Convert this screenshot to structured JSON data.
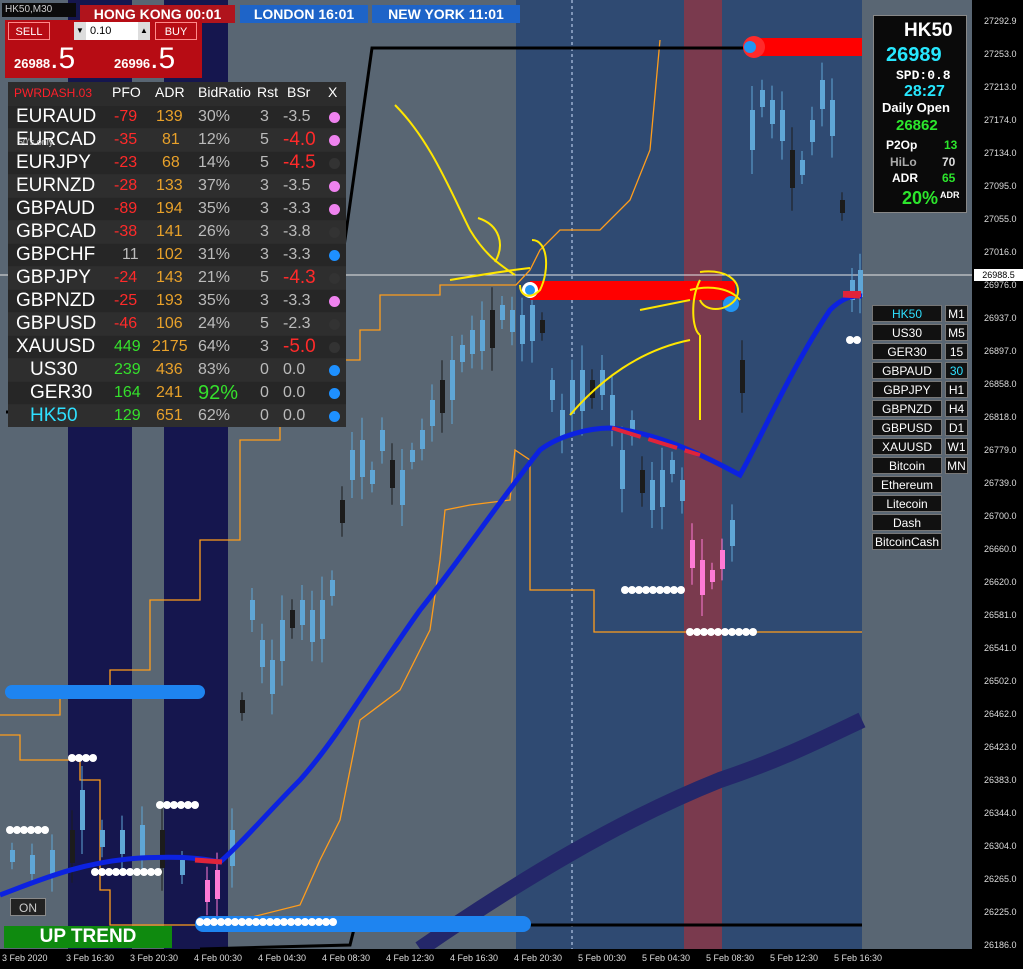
{
  "window": {
    "symbol_timeframe": "HK50,M30"
  },
  "sessions": {
    "hong_kong": "HONG KONG 00:01",
    "london": "LONDON  16:01",
    "new_york": "NEW YORK 11:01"
  },
  "trade_panel": {
    "sell_label": "SELL",
    "buy_label": "BUY",
    "lot": "0.10",
    "bid_main": "26988",
    "bid_pip": ".5",
    "ask_main": "26996",
    "ask_pip": ".5"
  },
  "dashboard": {
    "brand": "PWRDASH.03",
    "columns": [
      "PFO",
      "ADR",
      "BidRatio",
      "Rst",
      "BSr",
      "X"
    ],
    "rows": [
      {
        "pair": "EURAUD",
        "pfo": "-79",
        "adr": "139",
        "bid": "30%",
        "rst": "3",
        "bsr": "-3.5",
        "dot": "#ee82ee"
      },
      {
        "pair": "EURCAD",
        "pfo": "-35",
        "adr": "81",
        "bid": "12%",
        "rst": "5",
        "bsr": "-4.0",
        "dot": "#ee82ee"
      },
      {
        "pair": "EURJPY",
        "pfo": "-23",
        "adr": "68",
        "bid": "14%",
        "rst": "5",
        "bsr": "-4.5",
        "dot": "#333333"
      },
      {
        "pair": "EURNZD",
        "pfo": "-28",
        "adr": "133",
        "bid": "37%",
        "rst": "3",
        "bsr": "-3.5",
        "dot": "#ee82ee"
      },
      {
        "pair": "GBPAUD",
        "pfo": "-89",
        "adr": "194",
        "bid": "35%",
        "rst": "3",
        "bsr": "-3.3",
        "dot": "#ee82ee"
      },
      {
        "pair": "GBPCAD",
        "pfo": "-38",
        "adr": "141",
        "bid": "26%",
        "rst": "3",
        "bsr": "-3.8",
        "dot": "#333333"
      },
      {
        "pair": "GBPCHF",
        "pfo": "11",
        "adr": "102",
        "bid": "31%",
        "rst": "3",
        "bsr": "-3.3",
        "dot": "#1e90ff"
      },
      {
        "pair": "GBPJPY",
        "pfo": "-24",
        "adr": "143",
        "bid": "21%",
        "rst": "5",
        "bsr": "-4.3",
        "dot": "#333333"
      },
      {
        "pair": "GBPNZD",
        "pfo": "-25",
        "adr": "193",
        "bid": "35%",
        "rst": "3",
        "bsr": "-3.3",
        "dot": "#ee82ee"
      },
      {
        "pair": "GBPUSD",
        "pfo": "-46",
        "adr": "106",
        "bid": "24%",
        "rst": "5",
        "bsr": "-2.3",
        "dot": "#333333"
      },
      {
        "pair": "XAUUSD",
        "pfo": "449",
        "adr": "2175",
        "bid": "64%",
        "rst": "3",
        "bsr": "-5.0",
        "dot": "#333333"
      },
      {
        "pair": "US30",
        "pfo": "239",
        "adr": "436",
        "bid": "83%",
        "rst": "0",
        "bsr": "0.0",
        "dot": "#1e90ff"
      },
      {
        "pair": "GER30",
        "pfo": "164",
        "adr": "241",
        "bid": "92%",
        "rst": "0",
        "bsr": "0.0",
        "dot": "#1e90ff"
      },
      {
        "pair": "HK50",
        "pfo": "129",
        "adr": "651",
        "bid": "62%",
        "rst": "0",
        "bsr": "0.0",
        "dot": "#1e90ff"
      }
    ],
    "overlay_note": "50's only"
  },
  "info_box": {
    "symbol": "HK50",
    "price": "26989",
    "spread": "SPD:0.8",
    "timer": "28:27",
    "daily_open_label": "Daily Open",
    "daily_open": "26862",
    "p2op_label": "P2Op",
    "p2op": "13",
    "hilo_label": "HiLo",
    "hilo": "70",
    "adr_label": "ADR",
    "adr": "65",
    "adr_pct": "20%",
    "adr_pct_suffix": "ADR"
  },
  "symbol_list": [
    "HK50",
    "US30",
    "GER30",
    "GBPAUD",
    "GBPJPY",
    "GBPNZD",
    "GBPUSD",
    "XAUUSD",
    "Bitcoin",
    "Ethereum",
    "Litecoin",
    "Dash",
    "BitcoinCash"
  ],
  "timeframes": [
    "M1",
    "M5",
    "15",
    "30",
    "H1",
    "H4",
    "D1",
    "W1",
    "MN"
  ],
  "active_symbol": "HK50",
  "active_timeframe": "30",
  "bottom": {
    "on_label": "ON",
    "trend_label": "UP TREND"
  },
  "y_axis_labels": [
    "27292.9",
    "27253.0",
    "27213.0",
    "27174.0",
    "27134.0",
    "27095.0",
    "27055.0",
    "27016.0",
    "26976.0",
    "26937.0",
    "26897.0",
    "26858.0",
    "26818.0",
    "26779.0",
    "26739.0",
    "26700.0",
    "26660.0",
    "26620.0",
    "26581.0",
    "26541.0",
    "26502.0",
    "26462.0",
    "26423.0",
    "26383.0",
    "26344.0",
    "26304.0",
    "26265.0",
    "26225.0",
    "26186.0"
  ],
  "current_price_label": "26988.5",
  "x_axis_labels": [
    "3 Feb 2020",
    "3 Feb 16:30",
    "3 Feb 20:30",
    "4 Feb 00:30",
    "4 Feb 04:30",
    "4 Feb 08:30",
    "4 Feb 12:30",
    "4 Feb 16:30",
    "4 Feb 20:30",
    "5 Feb 00:30",
    "5 Feb 04:30",
    "5 Feb 08:30",
    "5 Feb 12:30",
    "5 Feb 16:30"
  ],
  "colors": {
    "chart_bg": "#596673",
    "session_blue": "#2f4a72",
    "session_navy": "#15164e",
    "session_red": "#7a3a4e",
    "candle_up": "#5fa6d6",
    "candle_down": "#1c1c1c",
    "candle_pink": "#ff7ad6",
    "ma_blue": "#0c22e0",
    "ma_thick": "#24276a",
    "channel": "#ff9d1c",
    "level_black": "#000000",
    "annotation": "#ffe600"
  }
}
